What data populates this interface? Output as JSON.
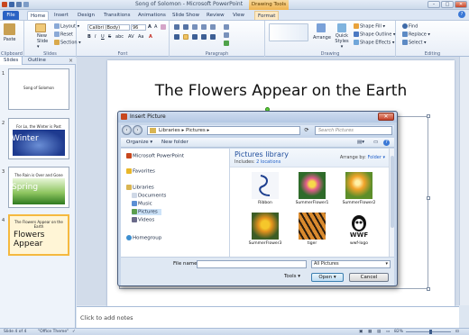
{
  "app": {
    "title": "Song of Solomon - Microsoft PowerPoint",
    "drawing_tools": "Drawing Tools",
    "min": "–",
    "max": "□",
    "close": "✕"
  },
  "tabs": [
    "File",
    "Home",
    "Insert",
    "Design",
    "Transitions",
    "Animations",
    "Slide Show",
    "Review",
    "View",
    "Format"
  ],
  "ribbon": {
    "clipboard": {
      "label": "Clipboard",
      "paste": "Paste"
    },
    "slides": {
      "label": "Slides",
      "new_slide": "New Slide ▾",
      "layout": "Layout ▾",
      "reset": "Reset",
      "section": "Section ▾"
    },
    "font": {
      "label": "Font",
      "font_name": "Calibri (Body)",
      "font_size": "96"
    },
    "paragraph": {
      "label": "Paragraph"
    },
    "drawing": {
      "label": "Drawing",
      "arrange": "Arrange",
      "quick_styles": "Quick Styles ▾",
      "shape_fill": "Shape Fill ▾",
      "shape_outline": "Shape Outline ▾",
      "shape_effects": "Shape Effects ▾"
    },
    "editing": {
      "label": "Editing",
      "find": "Find",
      "replace": "Replace ▾",
      "select": "Select ▾"
    },
    "help": "?"
  },
  "sidebar": {
    "tabs": [
      "Slides",
      "Outline"
    ],
    "close": "×",
    "thumbnails": [
      {
        "num": "1",
        "title": "Song of Solomon",
        "big": ""
      },
      {
        "num": "2",
        "title": "For Lo, the Winter is Past",
        "big": "Winter"
      },
      {
        "num": "3",
        "title": "The Rain is Over and Gone",
        "big": "Spring"
      },
      {
        "num": "4",
        "title": "The Flowers Appear on the Earth",
        "big": "Flowers Appear"
      }
    ]
  },
  "slide": {
    "title": "The Flowers Appear on the Earth"
  },
  "notes": {
    "placeholder": "Click to add notes"
  },
  "status": {
    "slide": "Slide 4 of 4",
    "theme": "\"Office Theme\"",
    "zoom": "82%"
  },
  "dialog": {
    "title": "Insert Picture",
    "close": "✕",
    "path": "Libraries ▸ Pictures ▸",
    "search_placeholder": "Search Pictures",
    "organize": "Organize ▾",
    "new_folder": "New folder",
    "nav": [
      "Microsoft PowerPoint",
      "Favorites",
      "Libraries",
      "Documents",
      "Music",
      "Pictures",
      "Videos",
      "Homegroup"
    ],
    "library_title": "Pictures library",
    "includes_prefix": "Includes: ",
    "includes_link": "2 locations",
    "arrange_label": "Arrange by: ",
    "arrange_value": "Folder ▾",
    "files": [
      "Ribbon",
      "SummerFlower1",
      "SummerFlower2",
      "SummerFlower3",
      "tiger",
      "wwf-logo"
    ],
    "wwf_text": "WWF",
    "file_name_label": "File name:",
    "file_name_value": "",
    "filter": "All Pictures",
    "tools": "Tools ▾",
    "open": "Open ▾",
    "cancel": "Cancel"
  }
}
